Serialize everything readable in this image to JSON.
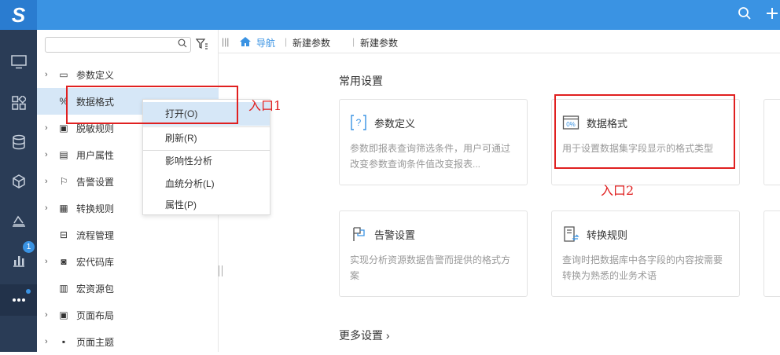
{
  "topbar": {
    "logo": "S",
    "search_icon": "search-icon",
    "add_icon": "plus-icon"
  },
  "leftnav": {
    "badge": "1"
  },
  "tree": {
    "search_placeholder": "",
    "items": [
      {
        "label": "参数定义",
        "icon": "parameter-icon",
        "expand": true
      },
      {
        "label": "数据格式",
        "icon": "data-format-icon",
        "expand": false,
        "selected": true
      },
      {
        "label": "脱敏规则",
        "icon": "desensitize-icon",
        "expand": true
      },
      {
        "label": "用户属性",
        "icon": "user-attribute-icon",
        "expand": true
      },
      {
        "label": "告警设置",
        "icon": "alarm-flag-icon",
        "expand": true
      },
      {
        "label": "转换规则",
        "icon": "convert-rule-icon",
        "expand": true
      },
      {
        "label": "流程管理",
        "icon": "process-icon",
        "expand": false
      },
      {
        "label": "宏代码库",
        "icon": "macro-icon",
        "expand": true
      },
      {
        "label": "宏资源包",
        "icon": "macro-package-icon",
        "expand": false
      },
      {
        "label": "页面布局",
        "icon": "page-layout-icon",
        "expand": true
      },
      {
        "label": "页面主题",
        "icon": "page-theme-icon",
        "expand": true
      }
    ]
  },
  "context_menu": {
    "items": [
      "打开(O)",
      "刷新(R)",
      "影响性分析",
      "血统分析(L)",
      "属性(P)"
    ]
  },
  "annotations": {
    "entry1": "入口1",
    "entry2": "入口2"
  },
  "breadcrumb": {
    "home": "导航",
    "tab1": "新建参数",
    "tab2": "新建参数"
  },
  "main": {
    "common_title": "常用设置",
    "more_title": "更多设置",
    "cards": [
      {
        "title": "参数定义",
        "desc": "参数即报表查询筛选条件，用户可通过改变参数查询条件值改变报表..."
      },
      {
        "title": "数据格式",
        "desc": "用于设置数据集字段显示的格式类型"
      },
      {
        "title": "告警设置",
        "desc": "实现分析资源数据告警而提供的格式方案"
      },
      {
        "title": "转换规则",
        "desc": "查询时把数据库中各字段的内容按需要转换为熟悉的业务术语"
      }
    ]
  },
  "colors": {
    "accent": "#3a93e3",
    "nav_bg": "#2a3c56",
    "selected_bg": "#d6e7f7",
    "annotation": "#e02020"
  }
}
